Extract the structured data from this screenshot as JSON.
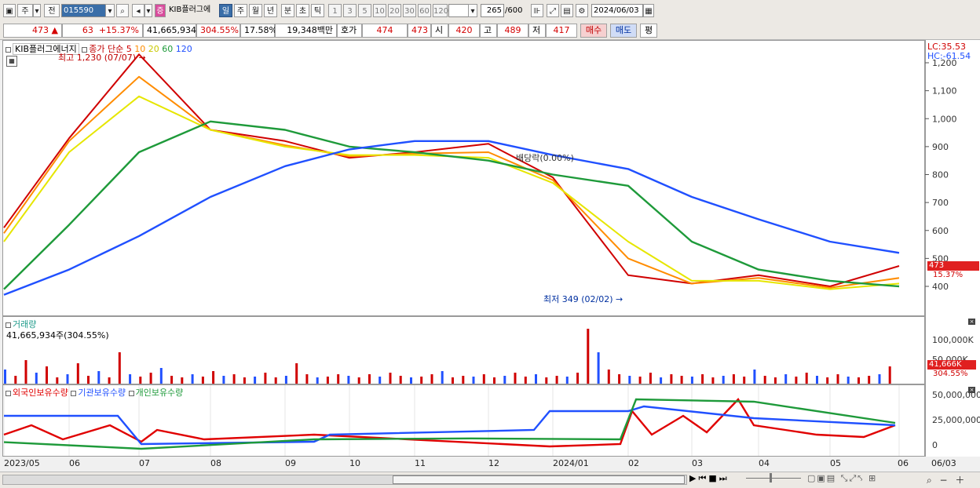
{
  "toolbar": {
    "period_label": "주",
    "prev_label": "전",
    "code_value": "015590",
    "stock_name": "KIB플러그에",
    "tf": [
      "일",
      "주",
      "월",
      "년",
      "분",
      "초",
      "틱"
    ],
    "nums": [
      "1",
      "3",
      "5",
      "10",
      "20",
      "30",
      "60",
      "120"
    ],
    "count": "265",
    "total": "/600",
    "date": "2024/06/03"
  },
  "quote": {
    "price": "473",
    "change": "63",
    "change_pct": "+15.37%",
    "volume": "41,665,934",
    "vol_ratio": "304.55%",
    "turnover": "17.58%",
    "amount": "19,348백만",
    "hoga_label": "호가",
    "ask": "474",
    "bid": "473",
    "open_label": "시",
    "open": "420",
    "high_label": "고",
    "high": "489",
    "low_label": "저",
    "low": "417",
    "buy_label": "매수",
    "sell_label": "매도",
    "eval_label": "평"
  },
  "price_panel": {
    "legend_name": "KIB플러그에너지",
    "legend_ma": "종가 단순",
    "ma_periods": [
      "5",
      "10",
      "20",
      "60",
      "120"
    ],
    "ma_colors": [
      "#d00000",
      "#ff8c00",
      "#e6e600",
      "#1e9a3a",
      "#2050ff"
    ],
    "high_note": "최고 1,230 (07/07)",
    "low_note": "최저 349 (02/02)",
    "div_note": "배당락(0.00%)",
    "lc": "LC:35.53",
    "hc": "HC:-61.54",
    "last_price": "473",
    "last_pct": "15.37%"
  },
  "vol_panel": {
    "title": "거래량",
    "value": "41,665,934주(304.55%)",
    "axis": [
      "100,000K",
      "50,000K"
    ],
    "last": "41,666K",
    "last_pct": "304.55%"
  },
  "hold_panel": {
    "series": [
      "외국인보유수량",
      "기관보유수량",
      "개인보유수량"
    ],
    "colors": [
      "#e00000",
      "#2050ff",
      "#1e9a3a"
    ],
    "axis": [
      "50,000,000",
      "25,000,000",
      "0"
    ]
  },
  "x_labels": [
    "2023/05",
    "06",
    "07",
    "08",
    "09",
    "10",
    "11",
    "12",
    "2024/01",
    "02",
    "03",
    "04",
    "05",
    "06",
    "06/03"
  ],
  "chart_data": {
    "type": "line",
    "title": "",
    "ylabel": "",
    "ylim": [
      300,
      1260
    ],
    "y_ticks": [
      400,
      500,
      600,
      700,
      800,
      900,
      1000,
      1100,
      1200
    ],
    "x": [
      "2023/05",
      "06",
      "07",
      "08",
      "09",
      "10",
      "11",
      "12",
      "2024/01",
      "02",
      "03",
      "04",
      "05",
      "06"
    ],
    "series": [
      {
        "name": "5",
        "values": [
          610,
          930,
          1230,
          960,
          920,
          860,
          880,
          910,
          790,
          440,
          410,
          440,
          400,
          473
        ]
      },
      {
        "name": "10",
        "values": [
          590,
          920,
          1150,
          960,
          905,
          865,
          875,
          880,
          780,
          500,
          410,
          430,
          395,
          430
        ]
      },
      {
        "name": "20",
        "values": [
          560,
          880,
          1080,
          960,
          900,
          870,
          870,
          860,
          770,
          560,
          420,
          420,
          390,
          410
        ]
      },
      {
        "name": "60",
        "values": [
          390,
          620,
          880,
          990,
          960,
          900,
          880,
          850,
          800,
          760,
          560,
          460,
          420,
          400
        ]
      },
      {
        "name": "120",
        "values": [
          370,
          460,
          580,
          720,
          830,
          890,
          920,
          920,
          870,
          820,
          720,
          640,
          560,
          520
        ]
      }
    ],
    "volume_axis": [
      "100,000K",
      "50,000K"
    ],
    "holdings_axis": [
      "50,000,000",
      "25,000,000",
      "0"
    ]
  }
}
